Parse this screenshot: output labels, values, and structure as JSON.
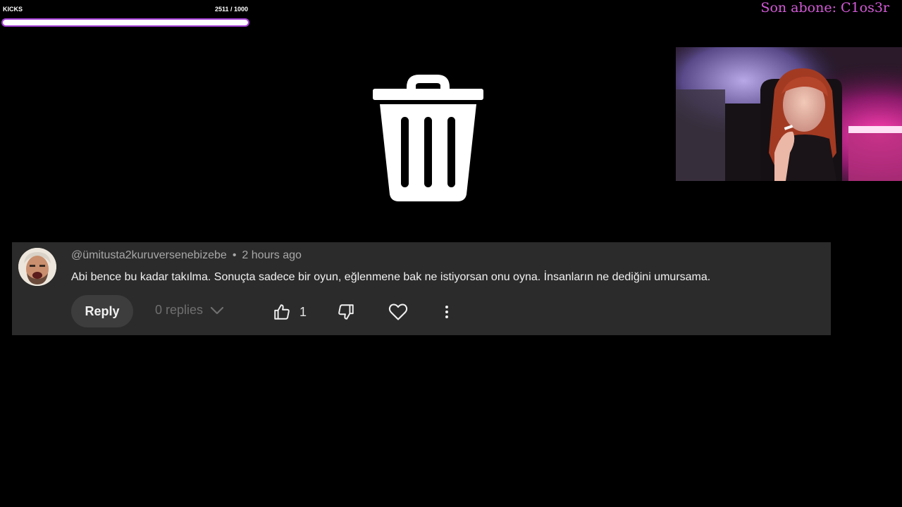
{
  "overlay": {
    "kicks_label": "KICKS",
    "kicks_value": "2511 / 1000",
    "kicks_progress": 1.0,
    "latest_sub": "Son abone: C1os3r",
    "accent_color": "#d45ad8",
    "bar_border_color": "#a43fd3"
  },
  "center_icon": "trash-icon",
  "comment": {
    "author": "@ümitusta2kuruversenebizebe",
    "separator": "•",
    "time": "2 hours ago",
    "text": "Abi bence bu kadar takılma. Sonuçta sadece bir oyun, eğlenmene bak ne istiyorsan onu oyna. İnsanların ne dediğini umursama.",
    "reply_label": "Reply",
    "replies_label": "0 replies",
    "like_count": "1",
    "icons": [
      "thumbs-up-icon",
      "thumbs-down-icon",
      "heart-icon",
      "more-vertical-icon",
      "chevron-down-icon"
    ],
    "card_color": "#2b2b2b"
  }
}
